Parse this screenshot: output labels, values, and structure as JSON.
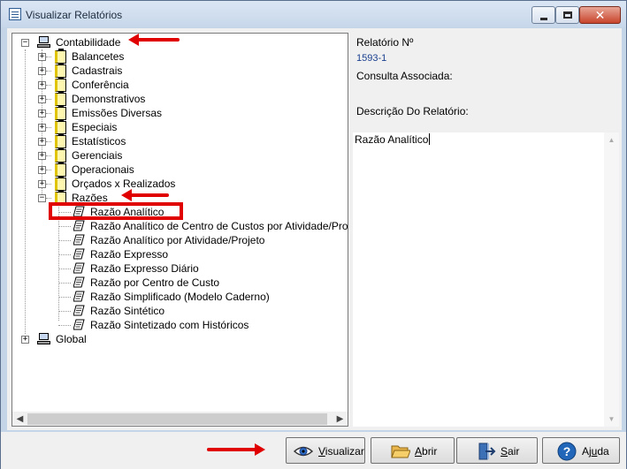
{
  "window": {
    "title": "Visualizar Relatórios"
  },
  "tree": {
    "root": {
      "label": "Contabilidade",
      "expanded": true
    },
    "groups": [
      {
        "label": "Balancetes"
      },
      {
        "label": "Cadastrais"
      },
      {
        "label": "Conferência"
      },
      {
        "label": "Demonstrativos"
      },
      {
        "label": "Emissões Diversas"
      },
      {
        "label": "Especiais"
      },
      {
        "label": "Estatísticos"
      },
      {
        "label": "Gerenciais"
      },
      {
        "label": "Operacionais"
      },
      {
        "label": "Orçados x Realizados"
      },
      {
        "label": "Razões",
        "expanded": true
      }
    ],
    "reports": [
      {
        "label": "Razão Analítico",
        "selected": true
      },
      {
        "label": "Razão Analítico de Centro de Custos por Atividade/Projet"
      },
      {
        "label": "Razão Analítico por Atividade/Projeto"
      },
      {
        "label": "Razão Expresso"
      },
      {
        "label": "Razão Expresso Diário"
      },
      {
        "label": "Razão por Centro de Custo"
      },
      {
        "label": "Razão Simplificado (Modelo Caderno)"
      },
      {
        "label": "Razão Sintético"
      },
      {
        "label": "Razão Sintetizado com Históricos"
      }
    ],
    "root2": {
      "label": "Global"
    }
  },
  "info": {
    "report_number_label": "Relatório Nº",
    "report_number": "1593-1",
    "query_label": "Consulta Associada:",
    "query_value": "",
    "description_label": "Descrição Do Relatório:",
    "description_value": "Razão Analítico"
  },
  "buttons": {
    "visualizar": {
      "access_key": "V",
      "rest": "isualizar"
    },
    "abrir": {
      "access_key": "A",
      "rest": "brir"
    },
    "sair": {
      "access_key": "S",
      "rest": "air"
    },
    "ajuda": {
      "prefix": "Aj",
      "access_key": "u",
      "rest": "da"
    }
  },
  "colors": {
    "accent_annotation": "#e00000",
    "link_value": "#1a3f8f"
  },
  "icons": {
    "root": "computer-icon",
    "group": "folder-icon",
    "report": "report-document-icon",
    "visualizar": "eye-icon",
    "abrir": "open-folder-icon",
    "sair": "exit-door-icon",
    "ajuda": "help-icon"
  }
}
